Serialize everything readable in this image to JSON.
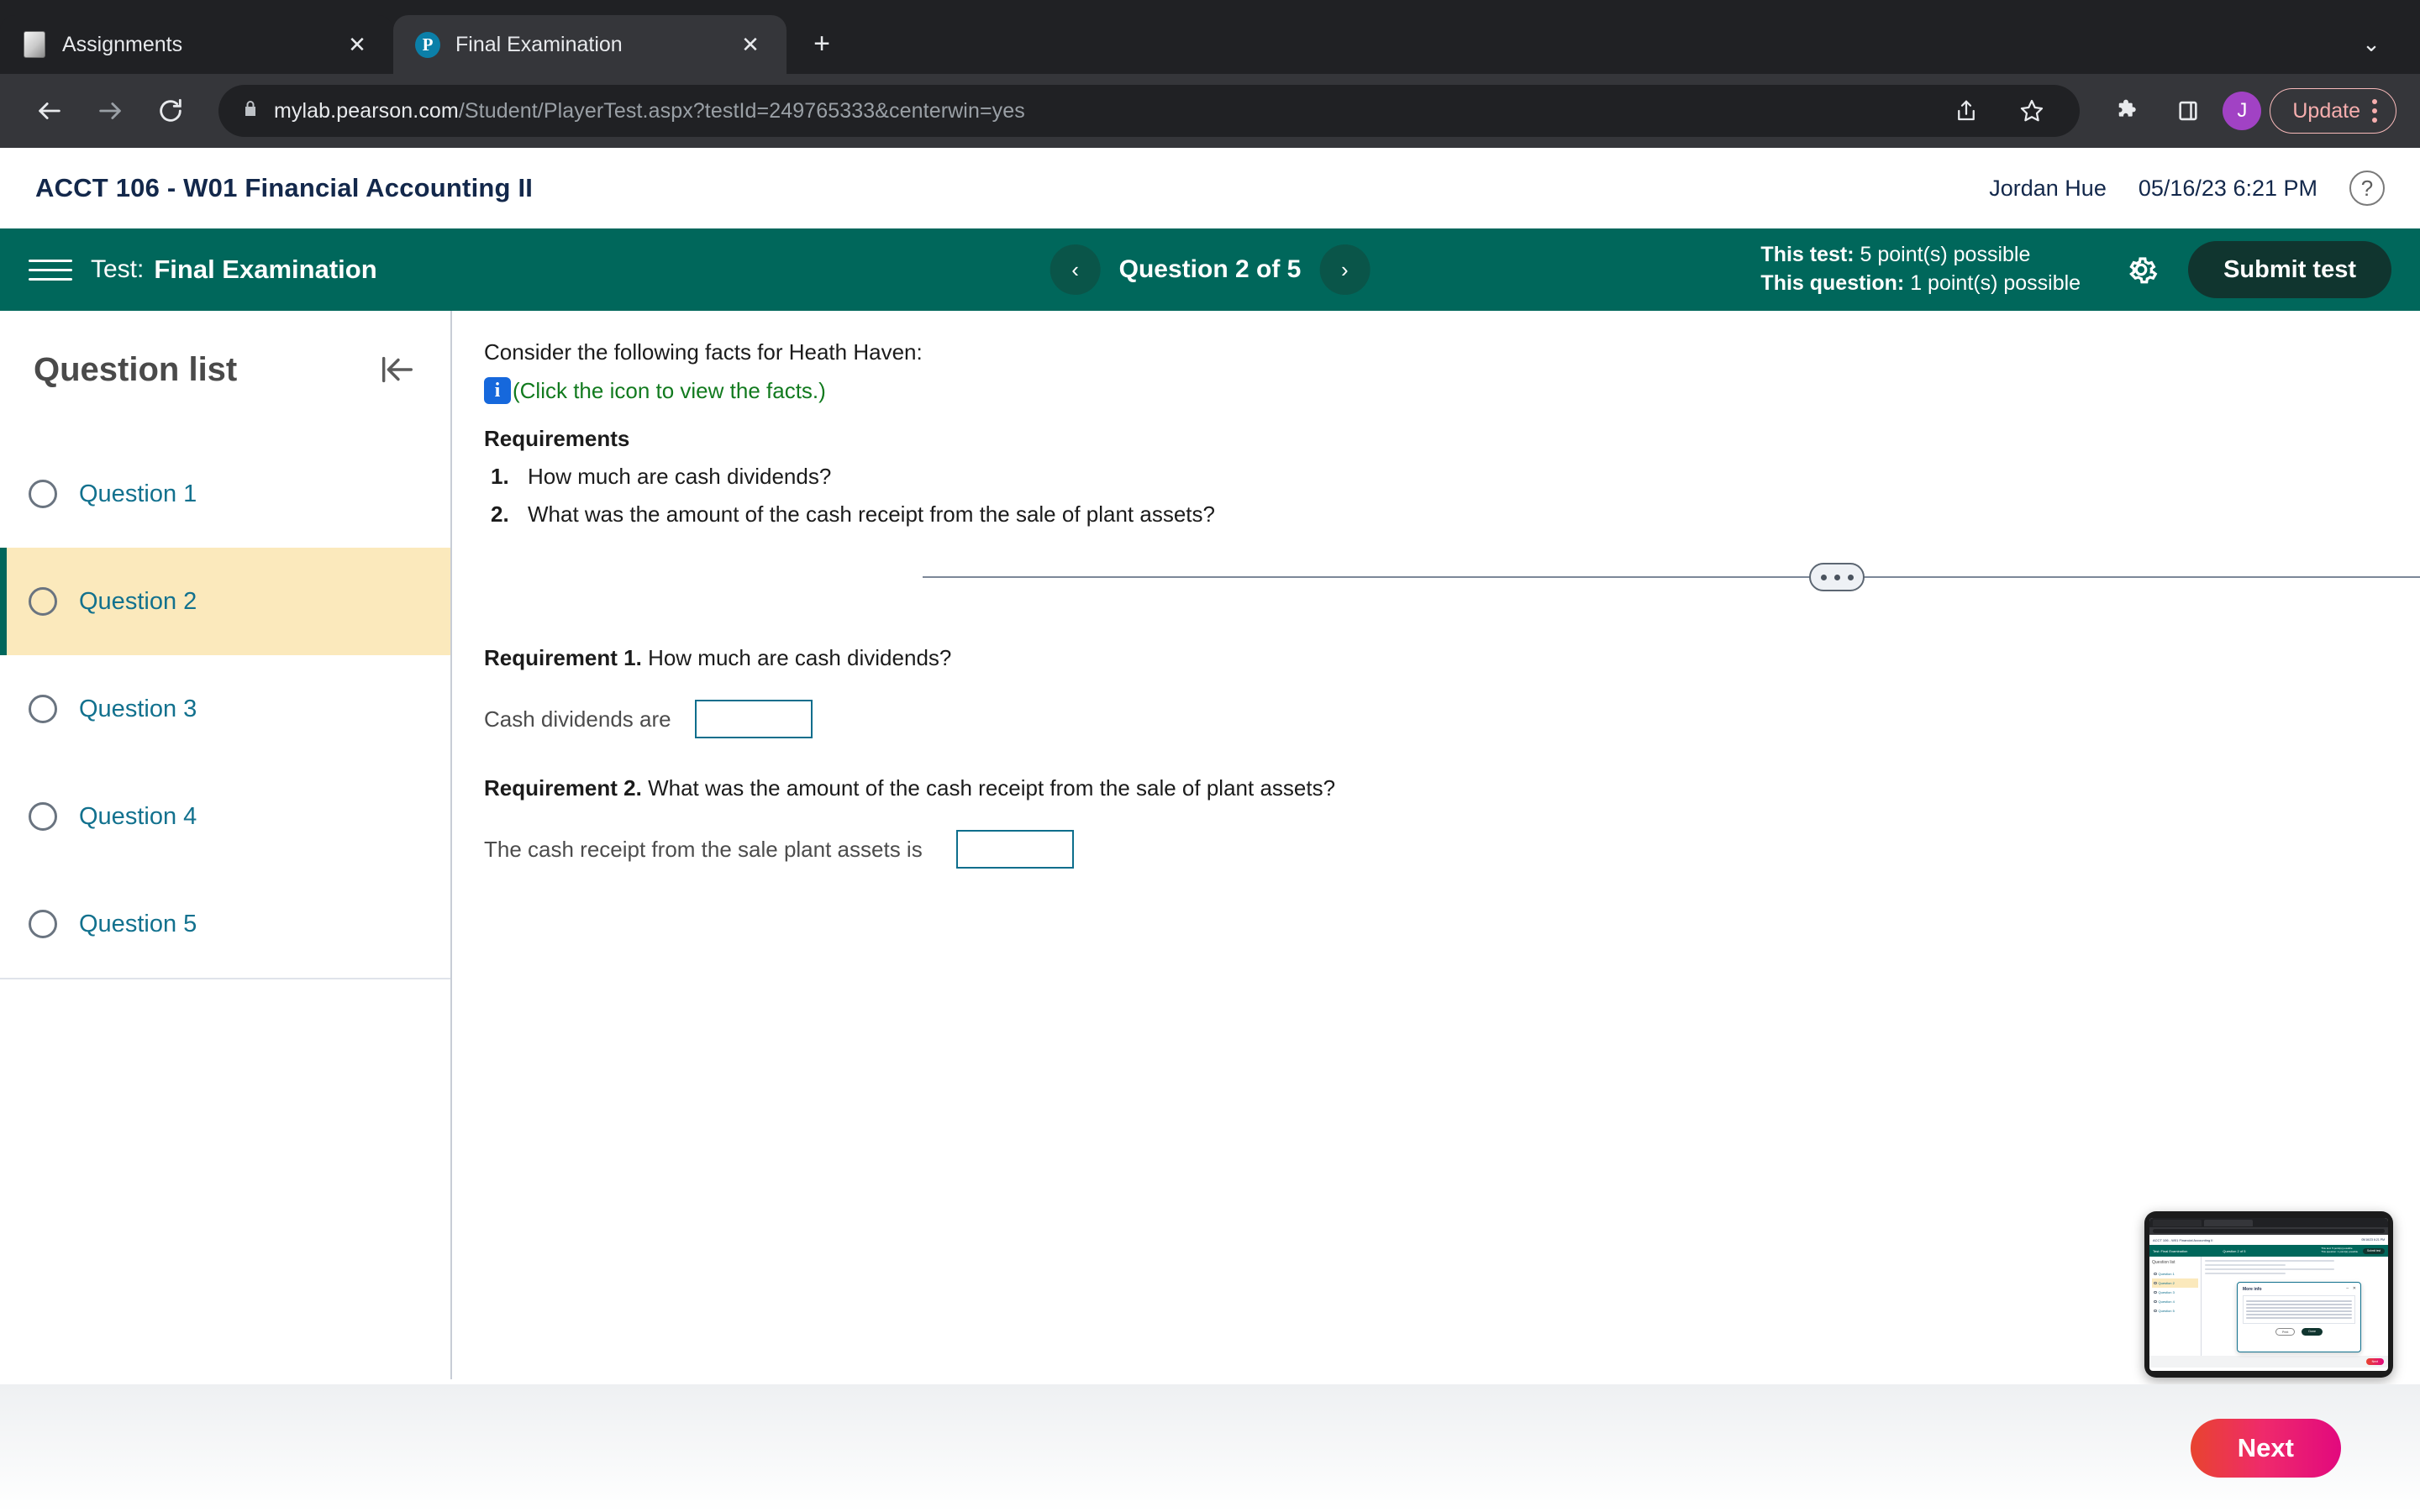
{
  "browser": {
    "tabs": [
      {
        "title": "Assignments",
        "favicon": "document-icon",
        "active": false
      },
      {
        "title": "Final Examination",
        "favicon": "pearson-p-icon",
        "active": true
      }
    ],
    "new_tab_label": "+",
    "tab_search_icon": "chevron-down-icon",
    "close_label": "✕",
    "nav": {
      "back": "←",
      "forward": "→",
      "reload": "⟳"
    },
    "omnibox": {
      "lock_icon": "lock-icon",
      "domain": "mylab.pearson.com",
      "path": "/Student/PlayerTest.aspx?testId=249765333&centerwin=yes",
      "share_icon": "share-icon",
      "bookmark_icon": "star-icon"
    },
    "extensions_icon": "puzzle-icon",
    "side_panel_icon": "side-panel-icon",
    "profile_initial": "J",
    "update_label": "Update",
    "menu_icon": "kebab-menu-icon"
  },
  "course_header": {
    "title": "ACCT 106 - W01 Financial Accounting II",
    "user": "Jordan Hue",
    "datetime": "05/16/23 6:21 PM",
    "help_label": "?"
  },
  "testbar": {
    "menu_icon": "hamburger-icon",
    "test_label": "Test:",
    "test_name": "Final Examination",
    "prev_icon": "‹",
    "next_icon": "›",
    "question_counter": "Question 2 of 5",
    "points_test_label": "This test:",
    "points_test_value": "5 point(s) possible",
    "points_question_label": "This question:",
    "points_question_value": "1 point(s) possible",
    "settings_icon": "gear-icon",
    "submit_label": "Submit test"
  },
  "sidebar": {
    "title": "Question list",
    "collapse_icon": "collapse-left-icon",
    "items": [
      {
        "label": "Question 1",
        "current": false
      },
      {
        "label": "Question 2",
        "current": true
      },
      {
        "label": "Question 3",
        "current": false
      },
      {
        "label": "Question 4",
        "current": false
      },
      {
        "label": "Question 5",
        "current": false
      }
    ]
  },
  "question": {
    "intro": "Consider the following facts for Heath Haven:",
    "info_icon": "info-icon",
    "facts_link": "(Click the icon to view the facts.)",
    "requirements_heading": "Requirements",
    "requirements": [
      {
        "num": "1.",
        "text": "How much are cash dividends?"
      },
      {
        "num": "2.",
        "text": "What was the amount of the cash receipt from the sale of plant assets?"
      }
    ]
  },
  "answers": {
    "divider_handle_icon": "drag-handle-dots-icon",
    "req1_label": "Requirement 1.",
    "req1_text": "How much are cash dividends?",
    "req1_input_label": "Cash dividends are",
    "req1_input_value": "",
    "req2_label": "Requirement 2.",
    "req2_text": "What was the amount of the cash receipt from the sale of plant assets?",
    "req2_input_label": "The cash receipt from the sale plant assets is",
    "req2_input_value": ""
  },
  "footer": {
    "next_label": "Next"
  },
  "thumbnail": {
    "course_title": "ACCT 106 - W01 Financial Accounting II",
    "user": "Jordan Hue",
    "datetime": "05/16/23 6:21 PM",
    "test_label": "Test: Final Examination",
    "question_counter": "Question 2 of 5",
    "points_test": "This test: 5 point(s) possible",
    "points_question": "This question: 1 point(s) possible",
    "submit_label": "Submit test",
    "sidebar_title": "Question list",
    "items": [
      "Question 1",
      "Question 2",
      "Question 3",
      "Question 4",
      "Question 5"
    ],
    "modal_title": "More info",
    "modal_minimize": "–",
    "modal_close": "✕",
    "modal_print": "Print",
    "modal_done": "Done",
    "next_label": "Next"
  },
  "colors": {
    "teal": "#00675b",
    "teal_dark": "#10352f",
    "link_blue": "#12718e",
    "highlight": "#fbe9bc",
    "next_pink": "#e2097e",
    "info_blue": "#1668dc",
    "facts_green": "#117a1e"
  }
}
